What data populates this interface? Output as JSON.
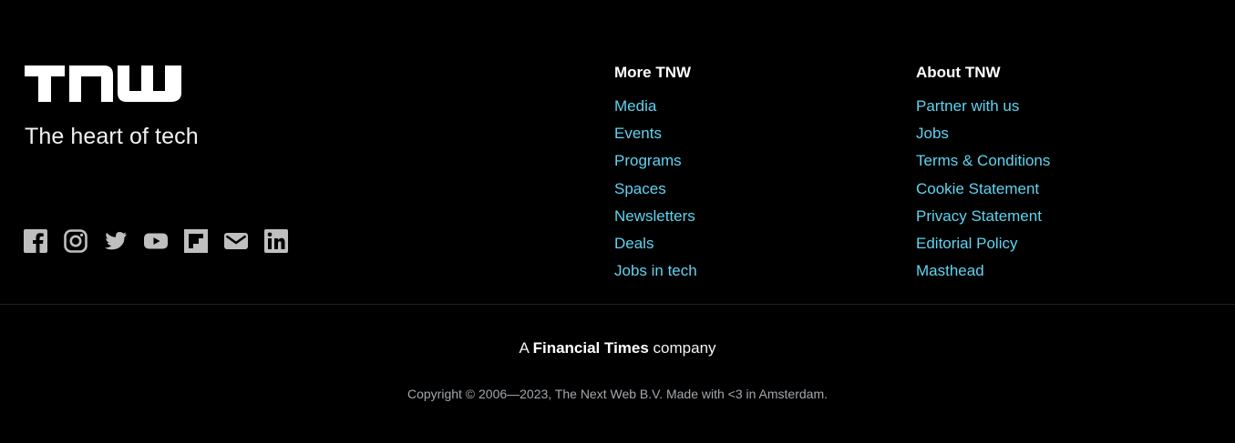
{
  "brand": {
    "logo_text": "TNW",
    "tagline": "The heart of tech"
  },
  "socials": [
    {
      "name": "facebook",
      "icon": "facebook-icon"
    },
    {
      "name": "instagram",
      "icon": "instagram-icon"
    },
    {
      "name": "twitter",
      "icon": "twitter-icon"
    },
    {
      "name": "youtube",
      "icon": "youtube-icon"
    },
    {
      "name": "flipboard",
      "icon": "flipboard-icon"
    },
    {
      "name": "email",
      "icon": "mail-icon"
    },
    {
      "name": "linkedin",
      "icon": "linkedin-icon"
    }
  ],
  "more_tnw": {
    "title": "More TNW",
    "links": [
      "Media",
      "Events",
      "Programs",
      "Spaces",
      "Newsletters",
      "Deals",
      "Jobs in tech"
    ]
  },
  "about_tnw": {
    "title": "About TNW",
    "links": [
      "Partner with us",
      "Jobs",
      "Terms & Conditions",
      "Cookie Statement",
      "Privacy Statement",
      "Editorial Policy",
      "Masthead"
    ]
  },
  "footer": {
    "ft_prefix": "A ",
    "ft_bold": "Financial Times",
    "ft_suffix": " company",
    "copyright": "Copyright © 2006—2023, The Next Web B.V. Made with <3 in Amsterdam."
  },
  "colors": {
    "background": "#000000",
    "link": "#5fd4f1",
    "icon": "#bfbfbf"
  }
}
